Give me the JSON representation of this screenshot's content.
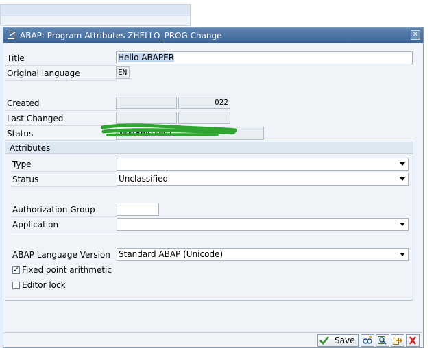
{
  "dialog": {
    "title": "ABAP: Program Attributes ZHELLO_PROG Change"
  },
  "header": {
    "title_label": "Title",
    "title_value": "Hello ABAPER",
    "orig_lang_label": "Original language",
    "orig_lang_value": "EN",
    "created_label": "Created",
    "created_date_fragment": "022",
    "last_changed_label": "Last Changed",
    "status_label": "Status",
    "status_value": "New(Revised)"
  },
  "attributes": {
    "group_label": "Attributes",
    "type_label": "Type",
    "type_value": "",
    "status_label": "Status",
    "status_value": "Unclassified",
    "auth_group_label": "Authorization Group",
    "auth_group_value": "",
    "application_label": "Application",
    "application_value": "",
    "abap_version_label": "ABAP Language Version",
    "abap_version_value": "Standard ABAP (Unicode)",
    "fixed_point_label": "Fixed point arithmetic",
    "fixed_point_checked": true,
    "editor_lock_label": "Editor lock",
    "editor_lock_checked": false
  },
  "toolbar": {
    "save_label": "Save",
    "icons": [
      "check-icon",
      "select-icon",
      "copy-icon",
      "cancel-icon"
    ]
  }
}
